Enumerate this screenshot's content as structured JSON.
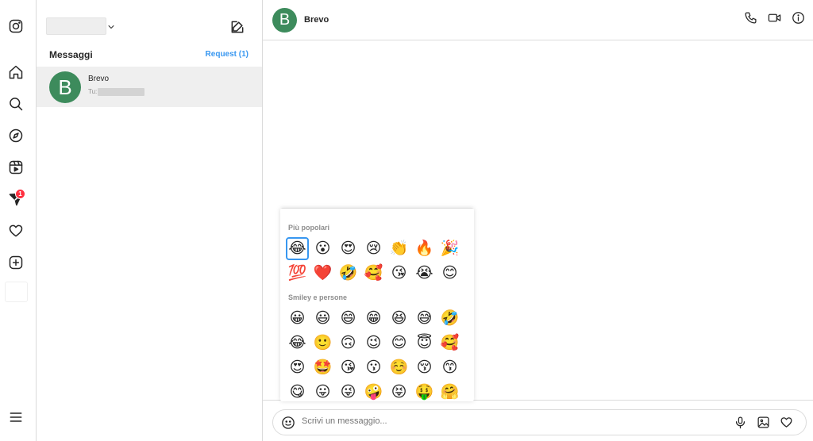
{
  "nav": {
    "items": [
      {
        "name": "instagram-icon"
      },
      {
        "name": "home-icon"
      },
      {
        "name": "search-icon"
      },
      {
        "name": "explore-icon"
      },
      {
        "name": "reels-icon"
      },
      {
        "name": "messages-icon"
      },
      {
        "name": "notifications-heart-icon"
      },
      {
        "name": "create-plus-icon"
      },
      {
        "name": "menu-icon"
      }
    ],
    "messages_badge": "1"
  },
  "inbox": {
    "title": "Messaggi",
    "request_label": "Request (1)",
    "threads": [
      {
        "avatar_letter": "B",
        "name": "Brevo",
        "preview_prefix": "Tu:"
      }
    ]
  },
  "chat": {
    "contact_name": "Brevo",
    "avatar_letter": "B",
    "header_icons": [
      "phone-icon",
      "video-call-icon",
      "info-icon"
    ]
  },
  "emoji_picker": {
    "sections": [
      {
        "title": "Più popolari",
        "emojis": [
          "😂",
          "😮",
          "😍",
          "😢",
          "👏",
          "🔥",
          "🎉",
          "💯",
          "❤️",
          "🤣",
          "🥰",
          "😘",
          "😭",
          "😊"
        ]
      },
      {
        "title": "Smiley e persone",
        "emojis": [
          "😀",
          "😃",
          "😄",
          "😁",
          "😆",
          "😅",
          "🤣",
          "😂",
          "🙂",
          "🙃",
          "😉",
          "😊",
          "😇",
          "🥰",
          "😍",
          "🤩",
          "😘",
          "😗",
          "☺️",
          "😚",
          "😙",
          "😋",
          "😛",
          "😜",
          "🤪",
          "😝",
          "🤑",
          "🤗"
        ]
      }
    ],
    "selected_emoji": "😂"
  },
  "composer": {
    "placeholder": "Scrivi un messaggio...",
    "icons": [
      "emoji-icon",
      "microphone-icon",
      "image-icon",
      "heart-icon"
    ]
  },
  "colors": {
    "accent": "#3897f0",
    "avatar_green": "#3d8b5c",
    "badge_red": "#ff3040",
    "border": "#dbdbdb"
  }
}
